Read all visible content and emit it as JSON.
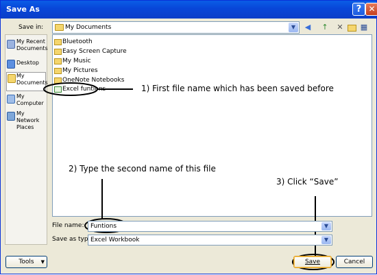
{
  "window": {
    "title": "Save As",
    "help_glyph": "?",
    "close_glyph": "✕"
  },
  "toolbar": {
    "save_in_label": "Save in:",
    "save_in_value": "My Documents",
    "back_glyph": "◀",
    "up_glyph": "↑",
    "delete_glyph": "✕",
    "views_glyph": "▦"
  },
  "places": [
    {
      "label": "My Recent Documents",
      "icon": "recent-documents-icon"
    },
    {
      "label": "Desktop",
      "icon": "desktop-icon"
    },
    {
      "label": "My Documents",
      "icon": "my-documents-icon"
    },
    {
      "label": "My Computer",
      "icon": "my-computer-icon"
    },
    {
      "label": "My Network Places",
      "icon": "network-places-icon"
    }
  ],
  "files": [
    {
      "name": "Bluetooth",
      "icon": "folder-icon"
    },
    {
      "name": "Easy Screen Capture",
      "icon": "folder-icon"
    },
    {
      "name": "My Music",
      "icon": "music-folder-icon"
    },
    {
      "name": "My Pictures",
      "icon": "pictures-folder-icon"
    },
    {
      "name": "OneNote Notebooks",
      "icon": "folder-icon"
    },
    {
      "name": "Excel funtions",
      "icon": "excel-file-icon"
    }
  ],
  "form": {
    "file_name_label": "File name:",
    "file_name_value": "Funtions",
    "save_as_type_label": "Save as type:",
    "save_as_type_value": "Excel Workbook"
  },
  "buttons": {
    "tools": "Tools",
    "save": "Save",
    "cancel": "Cancel"
  },
  "annotations": {
    "first": "1) First file name which has been saved before",
    "second": "2) Type the second name of this file",
    "third": "3) Click “Save”"
  }
}
